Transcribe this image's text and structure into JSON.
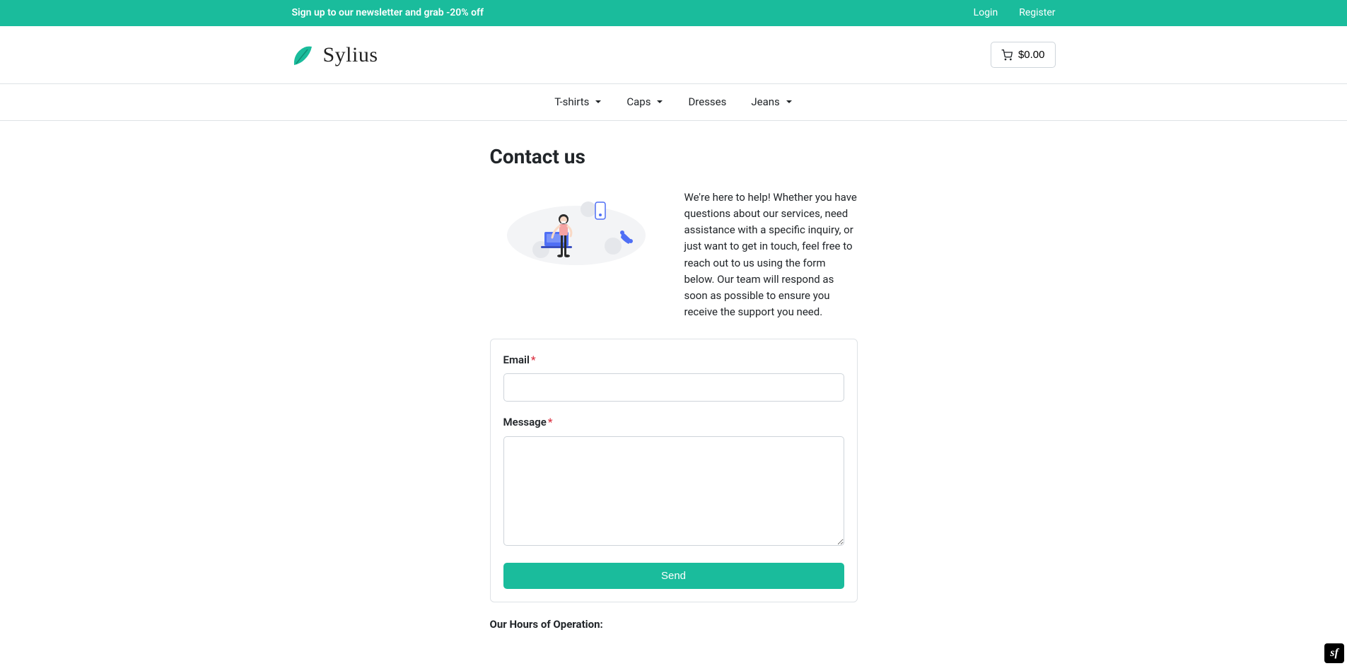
{
  "banner": {
    "newsletter_text": "Sign up to our newsletter and grab -20% off",
    "login_label": "Login",
    "register_label": "Register"
  },
  "header": {
    "brand_name": "Sylius",
    "cart_total": "$0.00"
  },
  "nav": {
    "items": [
      {
        "label": "T-shirts",
        "has_dropdown": true
      },
      {
        "label": "Caps",
        "has_dropdown": true
      },
      {
        "label": "Dresses",
        "has_dropdown": false
      },
      {
        "label": "Jeans",
        "has_dropdown": true
      }
    ]
  },
  "page": {
    "title": "Contact us",
    "intro_text": "We're here to help! Whether you have questions about our services, need assistance with a specific inquiry, or just want to get in touch, feel free to reach out to us using the form below. Our team will respond as soon as possible to ensure you receive the support you need."
  },
  "form": {
    "email_label": "Email",
    "email_value": "",
    "message_label": "Message",
    "message_value": "",
    "send_label": "Send"
  },
  "hours": {
    "heading": "Our Hours of Operation:"
  },
  "sf_badge": {
    "glyph": "sf"
  }
}
